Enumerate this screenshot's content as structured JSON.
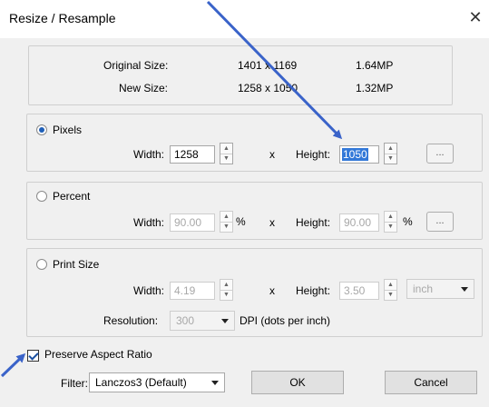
{
  "title": "Resize / Resample",
  "info": {
    "original_label": "Original Size:",
    "original_dims": "1401 x 1169",
    "original_mp": "1.64MP",
    "new_label": "New Size:",
    "new_dims": "1258 x 1050",
    "new_mp": "1.32MP"
  },
  "pixels": {
    "label": "Pixels",
    "selected": true,
    "width_label": "Width:",
    "width": "1258",
    "x": "x",
    "height_label": "Height:",
    "height": "1050",
    "more": "..."
  },
  "percent": {
    "label": "Percent",
    "width_label": "Width:",
    "width": "90.00",
    "unit": "%",
    "x": "x",
    "height_label": "Height:",
    "height": "90.00",
    "unit2": "%",
    "more": "..."
  },
  "print": {
    "label": "Print Size",
    "width_label": "Width:",
    "width": "4.19",
    "x": "x",
    "height_label": "Height:",
    "height": "3.50",
    "unit": "inch",
    "resolution_label": "Resolution:",
    "resolution": "300",
    "dpi_label": "DPI (dots per inch)"
  },
  "preserve": {
    "label": "Preserve Aspect Ratio",
    "checked": true
  },
  "filter": {
    "label": "Filter:",
    "value": "Lanczos3 (Default)"
  },
  "buttons": {
    "ok": "OK",
    "cancel": "Cancel"
  },
  "colors": {
    "annotation_arrow": "#3a63c9",
    "selection": "#3278d8"
  }
}
